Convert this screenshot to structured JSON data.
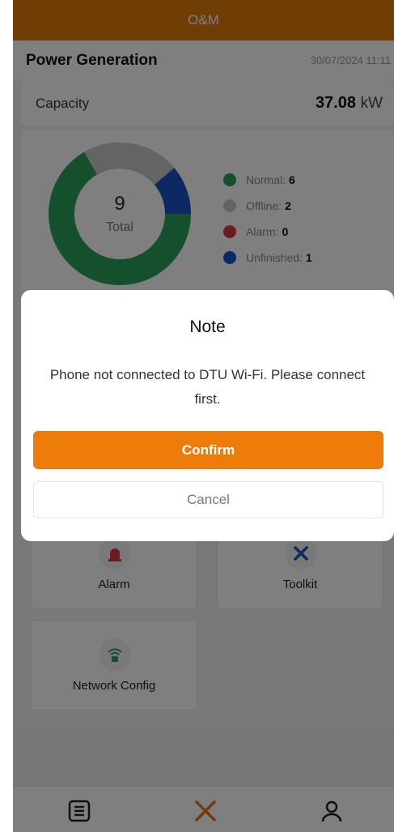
{
  "topbar": {
    "title": "O&M"
  },
  "power": {
    "title": "Power Generation",
    "timestamp": "30/07/2024 11:11",
    "capacity_label": "Capacity",
    "capacity_value": "37.08",
    "capacity_unit": "kW"
  },
  "status": {
    "total": "9",
    "total_label": "Total",
    "legend": [
      {
        "label": "Normal:",
        "count": "6",
        "color": "#2aa05a"
      },
      {
        "label": "Offline:",
        "count": "2",
        "color": "#c8c8cf"
      },
      {
        "label": "Alarm:",
        "count": "0",
        "color": "#d9363e"
      },
      {
        "label": "Unfinished:",
        "count": "1",
        "color": "#1a52c8"
      }
    ]
  },
  "tiles": [
    {
      "label": "Alarm",
      "icon": "siren-icon"
    },
    {
      "label": "Toolkit",
      "icon": "tools-icon"
    },
    {
      "label": "Network Config",
      "icon": "wifi-lock-icon"
    }
  ],
  "tabbar": [
    {
      "icon": "list-icon"
    },
    {
      "icon": "tools-icon"
    },
    {
      "icon": "user-icon"
    }
  ],
  "dialog": {
    "title": "Note",
    "message": "Phone not connected to DTU Wi-Fi. Please connect first.",
    "confirm": "Confirm",
    "cancel": "Cancel"
  },
  "colors": {
    "brand": "#e07b0b",
    "confirm": "#ee7c0b"
  }
}
